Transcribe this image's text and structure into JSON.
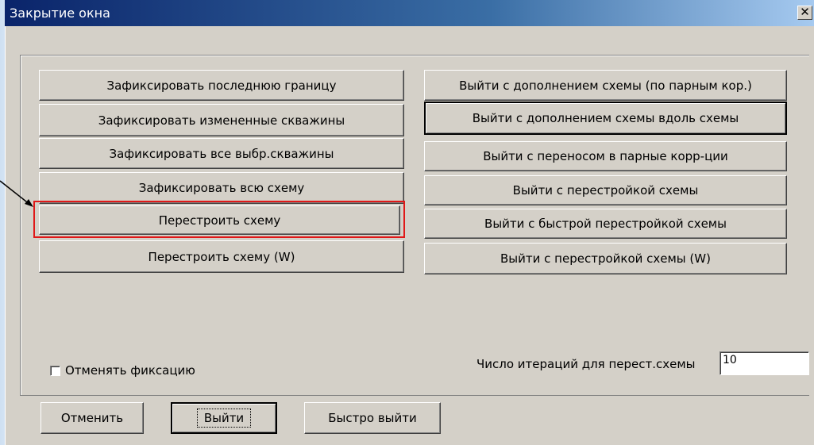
{
  "window": {
    "title": "Закрытие окна",
    "close_glyph": "✕"
  },
  "left_buttons": [
    "Зафиксировать последнюю границу",
    "Зафиксировать измененные скважины",
    "Зафиксировать все выбр.скважины",
    "Зафиксировать всю схему",
    "Перестроить схему",
    "Перестроить схему (W)"
  ],
  "right_buttons": [
    "Выйти с дополнением схемы (по парным кор.)",
    "Выйти с дополнением схемы вдоль схемы",
    "Выйти с переносом в парные корр-ции",
    "Выйти с перестройкой схемы",
    "Выйти с быстрой перестройкой схемы",
    "Выйти с перестройкой схемы (W)"
  ],
  "options": {
    "cancel_fixation_label": "Отменять фиксацию",
    "cancel_fixation_checked": false,
    "iterations_label": "Число итераций для перест.схемы",
    "iterations_value": "10"
  },
  "footer": {
    "cancel_label": "Отменить",
    "exit_label": "Выйти",
    "quick_exit_label": "Быстро выйти"
  },
  "annotation": {
    "highlight_color": "#e01818",
    "highlighted_button": "Перестроить схему"
  }
}
